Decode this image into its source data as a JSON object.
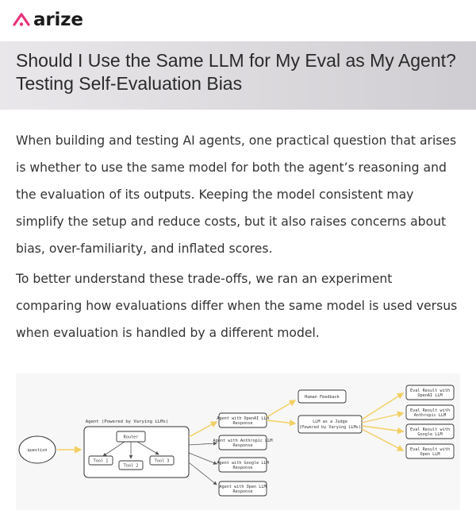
{
  "header": {
    "logo_text": "arize",
    "logo_accent": "#e8327a"
  },
  "article": {
    "title": "Should I Use the Same LLM for My Eval as My Agent? Testing Self-Evaluation Bias",
    "paragraphs": [
      "When building and testing AI agents, one practical question that arises is whether to use the same model for both the agent’s reasoning and the evaluation of its outputs. Keeping the model consistent may simplify the setup and reduce costs, but it also raises concerns about bias, over-familiarity, and inflated scores.",
      "To better understand these trade-offs, we ran an experiment comparing how evaluations differ when the same model is used versus when evaluation is handled by a different model."
    ]
  },
  "diagram": {
    "question": "question",
    "agent_label": "Agent (Powered by Varying LLMs)",
    "router": "Router",
    "tools": [
      "Tool 1",
      "Tool 2",
      "Tool 3"
    ],
    "agent_outputs": [
      [
        "Agent with OpenAI LLM",
        "Response"
      ],
      [
        "Agent with Anthropic LLM",
        "Response"
      ],
      [
        "Agent with Google LLM",
        "Response"
      ],
      [
        "Agent with Open LLM",
        "Response"
      ]
    ],
    "human_feedback": "Human Feedback",
    "judge": [
      "LLM as a Judge",
      "(Powered by Varying LLMs)"
    ],
    "eval_results": [
      [
        "Eval Result with",
        "OpenAI LLM"
      ],
      [
        "Eval Result with",
        "Anthropic LLM"
      ],
      [
        "Eval Result with",
        "Google LLM"
      ],
      [
        "Eval Result with",
        "Open LLM"
      ]
    ],
    "arrow_color": "#f5d778"
  }
}
